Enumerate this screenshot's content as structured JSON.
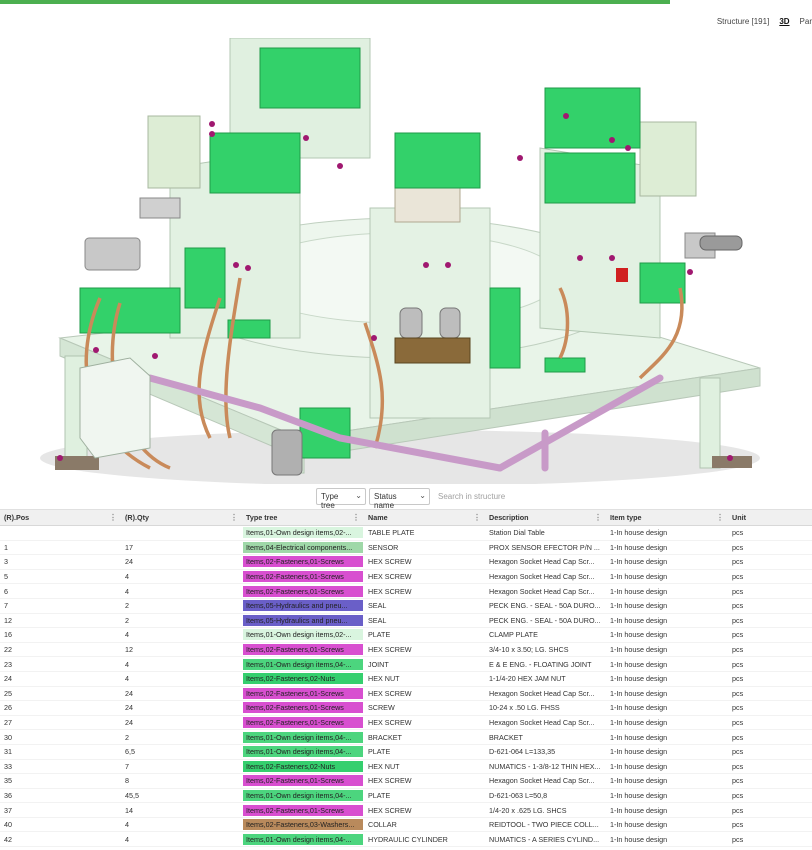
{
  "header": {
    "tabs": [
      {
        "label": "Structure [191]",
        "active": false
      },
      {
        "label": "3D",
        "active": true
      },
      {
        "label": "Par",
        "active": false
      }
    ],
    "accent_color": "#4caf50"
  },
  "viewport": {
    "content": "3D assembly model",
    "part_colors": {
      "frame": "#e4f2e4",
      "cylinders": "#33d16a",
      "hoses": "#c98a5a",
      "pipe": "#c89ac8"
    }
  },
  "filters": {
    "type_tree_label": "Type tree",
    "status_label": "Status name",
    "search_placeholder": "Search in structure"
  },
  "table": {
    "columns": [
      "(R).Pos",
      "(R).Qty",
      "Type tree",
      "Name",
      "Description",
      "Item type",
      "Unit"
    ],
    "type_colors": {
      "own": "#4cd57e",
      "own_light": "#d9f5df",
      "electrical": "#9fd8a8",
      "fasteners_screws": "#d84fd0",
      "hydraulics": "#6a5fc8",
      "nuts": "#35cf6e",
      "washers": "#b98a5c"
    },
    "rows": [
      {
        "pos": "",
        "qty": "",
        "type": "Items,01-Own design items,02-...",
        "type_color": "#d9f5df",
        "name": "TABLE PLATE",
        "desc": "Station Dial Table",
        "item_type": "1-In house design",
        "unit": "pcs"
      },
      {
        "pos": "1",
        "qty": "17",
        "type": "Items,04-Electrical components...",
        "type_color": "#9fd8a8",
        "name": "SENSOR",
        "desc": "PROX SENSOR EFECTOR P/N ...",
        "item_type": "1-In house design",
        "unit": "pcs"
      },
      {
        "pos": "3",
        "qty": "24",
        "type": "Items,02-Fasteners,01-Screws",
        "type_color": "#d84fd0",
        "name": "HEX SCREW",
        "desc": "Hexagon Socket Head Cap Scr...",
        "item_type": "1-In house design",
        "unit": "pcs"
      },
      {
        "pos": "5",
        "qty": "4",
        "type": "Items,02-Fasteners,01-Screws",
        "type_color": "#d84fd0",
        "name": "HEX SCREW",
        "desc": "Hexagon Socket Head Cap Scr...",
        "item_type": "1-In house design",
        "unit": "pcs"
      },
      {
        "pos": "6",
        "qty": "4",
        "type": "Items,02-Fasteners,01-Screws",
        "type_color": "#d84fd0",
        "name": "HEX SCREW",
        "desc": "Hexagon Socket Head Cap Scr...",
        "item_type": "1-In house design",
        "unit": "pcs"
      },
      {
        "pos": "7",
        "qty": "2",
        "type": "Items,05-Hydraulics and pneu...",
        "type_color": "#6a5fc8",
        "name": "SEAL",
        "desc": "PECK ENG. - SEAL - 50A DURO...",
        "item_type": "1-In house design",
        "unit": "pcs"
      },
      {
        "pos": "12",
        "qty": "2",
        "type": "Items,05-Hydraulics and pneu...",
        "type_color": "#6a5fc8",
        "name": "SEAL",
        "desc": "PECK ENG. - SEAL - 50A DURO...",
        "item_type": "1-In house design",
        "unit": "pcs"
      },
      {
        "pos": "16",
        "qty": "4",
        "type": "Items,01-Own design items,02-...",
        "type_color": "#d9f5df",
        "name": "PLATE",
        "desc": "CLAMP PLATE",
        "item_type": "1-In house design",
        "unit": "pcs"
      },
      {
        "pos": "22",
        "qty": "12",
        "type": "Items,02-Fasteners,01-Screws",
        "type_color": "#d84fd0",
        "name": "HEX SCREW",
        "desc": "3/4-10 x 3.50; LG. SHCS",
        "item_type": "1-In house design",
        "unit": "pcs"
      },
      {
        "pos": "23",
        "qty": "4",
        "type": "Items,01-Own design items,04-...",
        "type_color": "#4cd57e",
        "name": "JOINT",
        "desc": "E & E ENG. - FLOATING JOINT",
        "item_type": "1-In house design",
        "unit": "pcs"
      },
      {
        "pos": "24",
        "qty": "4",
        "type": "Items,02-Fasteners,02-Nuts",
        "type_color": "#35cf6e",
        "name": "HEX NUT",
        "desc": "1-1/4-20 HEX JAM NUT",
        "item_type": "1-In house design",
        "unit": "pcs"
      },
      {
        "pos": "25",
        "qty": "24",
        "type": "Items,02-Fasteners,01-Screws",
        "type_color": "#d84fd0",
        "name": "HEX SCREW",
        "desc": "Hexagon Socket Head Cap Scr...",
        "item_type": "1-In house design",
        "unit": "pcs"
      },
      {
        "pos": "26",
        "qty": "24",
        "type": "Items,02-Fasteners,01-Screws",
        "type_color": "#d84fd0",
        "name": "SCREW",
        "desc": "10-24 x .50 LG. FHSS",
        "item_type": "1-In house design",
        "unit": "pcs"
      },
      {
        "pos": "27",
        "qty": "24",
        "type": "Items,02-Fasteners,01-Screws",
        "type_color": "#d84fd0",
        "name": "HEX SCREW",
        "desc": "Hexagon Socket Head Cap Scr...",
        "item_type": "1-In house design",
        "unit": "pcs"
      },
      {
        "pos": "30",
        "qty": "2",
        "type": "Items,01-Own design items,04-...",
        "type_color": "#4cd57e",
        "name": "BRACKET",
        "desc": "BRACKET",
        "item_type": "1-In house design",
        "unit": "pcs"
      },
      {
        "pos": "31",
        "qty": "6,5",
        "type": "Items,01-Own design items,04-...",
        "type_color": "#4cd57e",
        "name": "PLATE",
        "desc": "D-621-064 L=133,35",
        "item_type": "1-In house design",
        "unit": "pcs"
      },
      {
        "pos": "33",
        "qty": "7",
        "type": "Items,02-Fasteners,02-Nuts",
        "type_color": "#35cf6e",
        "name": "HEX NUT",
        "desc": "NUMATICS - 1-3/8-12 THIN HEX...",
        "item_type": "1-In house design",
        "unit": "pcs"
      },
      {
        "pos": "35",
        "qty": "8",
        "type": "Items,02-Fasteners,01-Screws",
        "type_color": "#d84fd0",
        "name": "HEX SCREW",
        "desc": "Hexagon Socket Head Cap Scr...",
        "item_type": "1-In house design",
        "unit": "pcs"
      },
      {
        "pos": "36",
        "qty": "45,5",
        "type": "Items,01-Own design items,04-...",
        "type_color": "#4cd57e",
        "name": "PLATE",
        "desc": "D-621-063 L=50,8",
        "item_type": "1-In house design",
        "unit": "pcs"
      },
      {
        "pos": "37",
        "qty": "14",
        "type": "Items,02-Fasteners,01-Screws",
        "type_color": "#d84fd0",
        "name": "HEX SCREW",
        "desc": "1/4-20 x .625 LG. SHCS",
        "item_type": "1-In house design",
        "unit": "pcs"
      },
      {
        "pos": "40",
        "qty": "4",
        "type": "Items,02-Fasteners,03-Washers...",
        "type_color": "#b98a5c",
        "name": "COLLAR",
        "desc": "REIDTOOL - TWO PIECE COLL...",
        "item_type": "1-In house design",
        "unit": "pcs"
      },
      {
        "pos": "42",
        "qty": "4",
        "type": "Items,01-Own design items,04-...",
        "type_color": "#4cd57e",
        "name": "HYDRAULIC CYLINDER",
        "desc": "NUMATICS - A SERIES CYLIND...",
        "item_type": "1-In house design",
        "unit": "pcs"
      }
    ]
  }
}
